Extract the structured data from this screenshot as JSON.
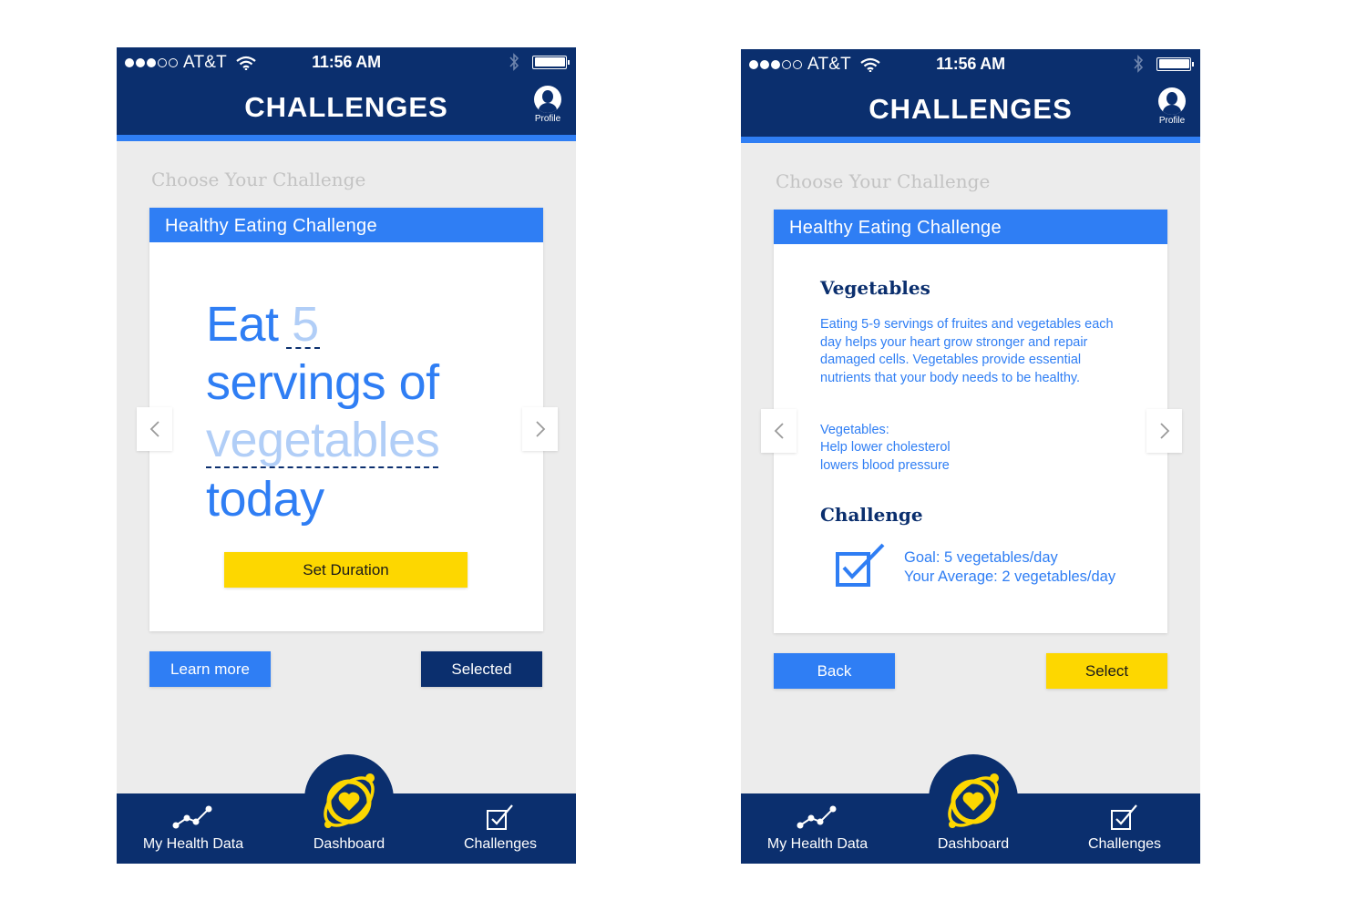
{
  "status_bar": {
    "carrier": "AT&T",
    "time": "11:56 AM"
  },
  "header": {
    "title": "CHALLENGES",
    "profile_label": "Profile"
  },
  "section_title": "Choose Your Challenge",
  "card_title": "Healthy Eating Challenge",
  "left_screen": {
    "statement": {
      "eat": "Eat",
      "quantity": "5",
      "servings": "servings of",
      "food": "vegetables",
      "today": "today"
    },
    "set_duration_label": "Set Duration",
    "learn_more_label": "Learn more",
    "selected_label": "Selected"
  },
  "right_screen": {
    "vegetables_heading": "Vegetables",
    "description": "Eating 5-9 servings of fruites and vegetables each day helps your heart grow stronger and repair damaged cells. Vegetables provide essential nutrients that your body needs to be healthy.",
    "benefits_title": "Vegetables:",
    "benefits": [
      "Help lower cholesterol",
      "lowers blood pressure"
    ],
    "challenge_heading": "Challenge",
    "goal": "Goal: 5 vegetables/day",
    "average": "Your Average: 2 vegetables/day",
    "back_label": "Back",
    "select_label": "Select"
  },
  "nav": {
    "health_label": "My Health Data",
    "dashboard_label": "Dashboard",
    "challenges_label": "Challenges"
  },
  "icons": [
    "wifi-icon",
    "bluetooth-icon",
    "battery-icon",
    "profile-icon",
    "chevron-left-icon",
    "chevron-right-icon",
    "checkbox-icon",
    "chart-line-icon",
    "heart-orbit-icon",
    "checkmark-box-icon"
  ],
  "colors": {
    "navy": "#0b2f6e",
    "blue": "#2f7ef4",
    "yellow": "#fdd700",
    "light_blue": "#b1cef7",
    "background": "#ececec"
  }
}
